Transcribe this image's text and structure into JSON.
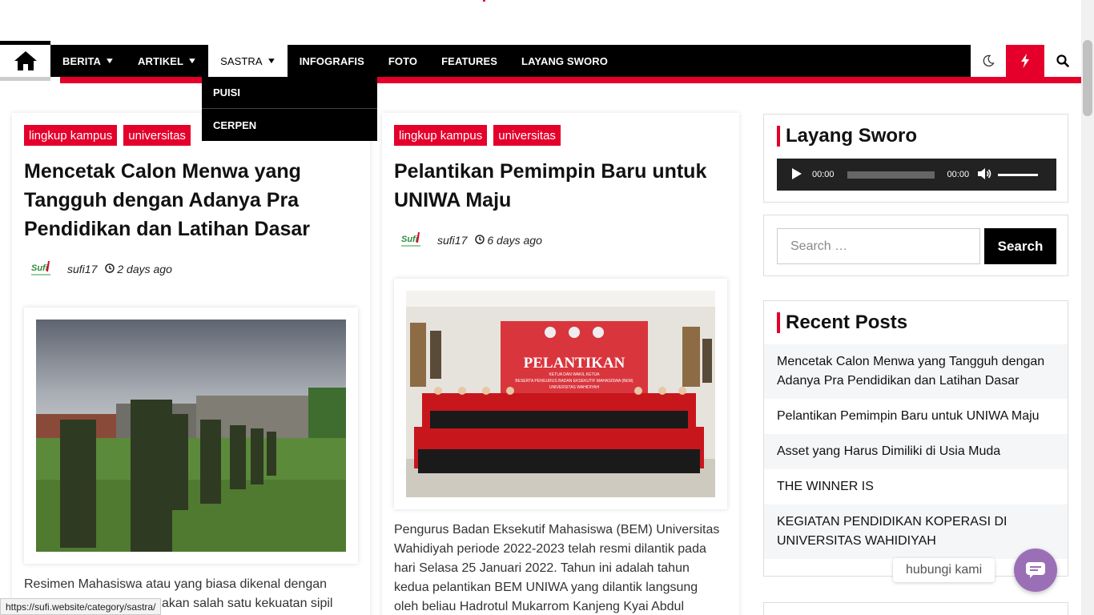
{
  "nav": {
    "items": [
      {
        "label": "BERITA",
        "has_caret": true
      },
      {
        "label": "ARTIKEL",
        "has_caret": true
      },
      {
        "label": "SASTRA",
        "has_caret": true
      },
      {
        "label": "INFOGRAFIS"
      },
      {
        "label": "FOTO"
      },
      {
        "label": "FEATURES"
      },
      {
        "label": "LAYANG SWORO"
      }
    ],
    "dropdown": [
      "PUISI",
      "CERPEN"
    ],
    "accent_color": "#e4002b"
  },
  "posts": [
    {
      "tags": [
        "lingkup kampus",
        "universitas"
      ],
      "title_lines": [
        "Mencetak Calon Menwa yang",
        "Tangguh dengan Adanya Pra",
        "Pendidikan dan Latihan Dasar"
      ],
      "author": "sufi17",
      "time": "2 days ago",
      "excerpt_lines": [
        "Resimen Mahasiswa atau yang biasa dikenal dengan",
        "akan salah satu kekuatan sipil"
      ]
    },
    {
      "tags": [
        "lingkup kampus",
        "universitas"
      ],
      "title_lines": [
        "Pelantikan Pemimpin Baru untuk",
        "UNIWA Maju"
      ],
      "author": "sufi17",
      "time": "6 days ago",
      "image_text": {
        "heading": "PELANTIKAN",
        "sub1": "KETUA DAN WAKIL KETUA",
        "sub2": "BESERTA PENGURUS BADAN EKSEKUTIF MAHASISWA (BEM)",
        "sub3": "UNIVERSITAS WAHIDIYAH"
      },
      "excerpt_lines": [
        "Pengurus Badan Eksekutif Mahasiswa (BEM) Universitas",
        "Wahidiyah periode 2022-2023 telah resmi dilantik pada",
        "hari Selasa 25 Januari 2022. Tahun ini adalah tahun",
        "kedua pelantikan BEM UNIWA yang dilantik langsung",
        "oleh beliau Hadrotul Mukarrom Kanjeng Kyai Abdul"
      ]
    }
  ],
  "sidebar": {
    "layang_title": "Layang Sworo",
    "audio": {
      "current": "00:00",
      "duration": "00:00"
    },
    "search_placeholder": "Search …",
    "search_button": "Search",
    "recent_title": "Recent Posts",
    "recent_posts": [
      "Mencetak Calon Menwa yang Tangguh dengan Adanya Pra Pendidikan dan Latihan Dasar",
      "Pelantikan Pemimpin Baru untuk UNIWA Maju",
      "Asset yang Harus Dimiliki di Usia Muda",
      "THE WINNER IS",
      "KEGIATAN PENDIDIKAN KOPERASI DI UNIVERSITAS WAHIDIYAH"
    ]
  },
  "chat": {
    "label": "hubungi kami",
    "color": "#9b6fb6"
  },
  "status_url": "https://sufi.website/category/sastra/"
}
